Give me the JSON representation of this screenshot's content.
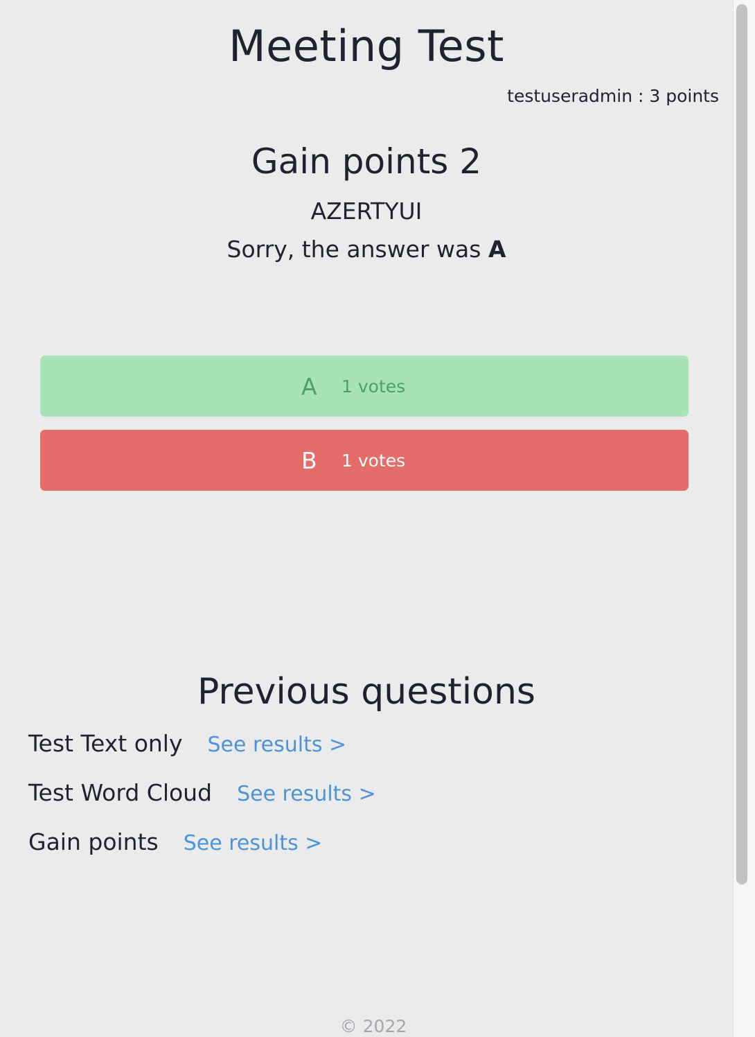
{
  "header": {
    "title": "Meeting Test",
    "user_points": "testuseradmin : 3 points"
  },
  "question": {
    "title": "Gain points 2",
    "text": "AZERTYUI",
    "result_prefix": "Sorry, the answer was ",
    "correct_answer": "A"
  },
  "options": [
    {
      "label": "A",
      "votes": "1 votes",
      "status": "correct",
      "color": "#a8e3b7"
    },
    {
      "label": "B",
      "votes": "1 votes",
      "status": "incorrect",
      "color": "#e46d6a"
    }
  ],
  "previous": {
    "title": "Previous questions",
    "items": [
      {
        "name": "Test Text only",
        "link": "See results >"
      },
      {
        "name": "Test Word Cloud",
        "link": "See results >"
      },
      {
        "name": "Gain points",
        "link": "See results >"
      }
    ]
  },
  "footer": {
    "copyright": "© 2022"
  }
}
